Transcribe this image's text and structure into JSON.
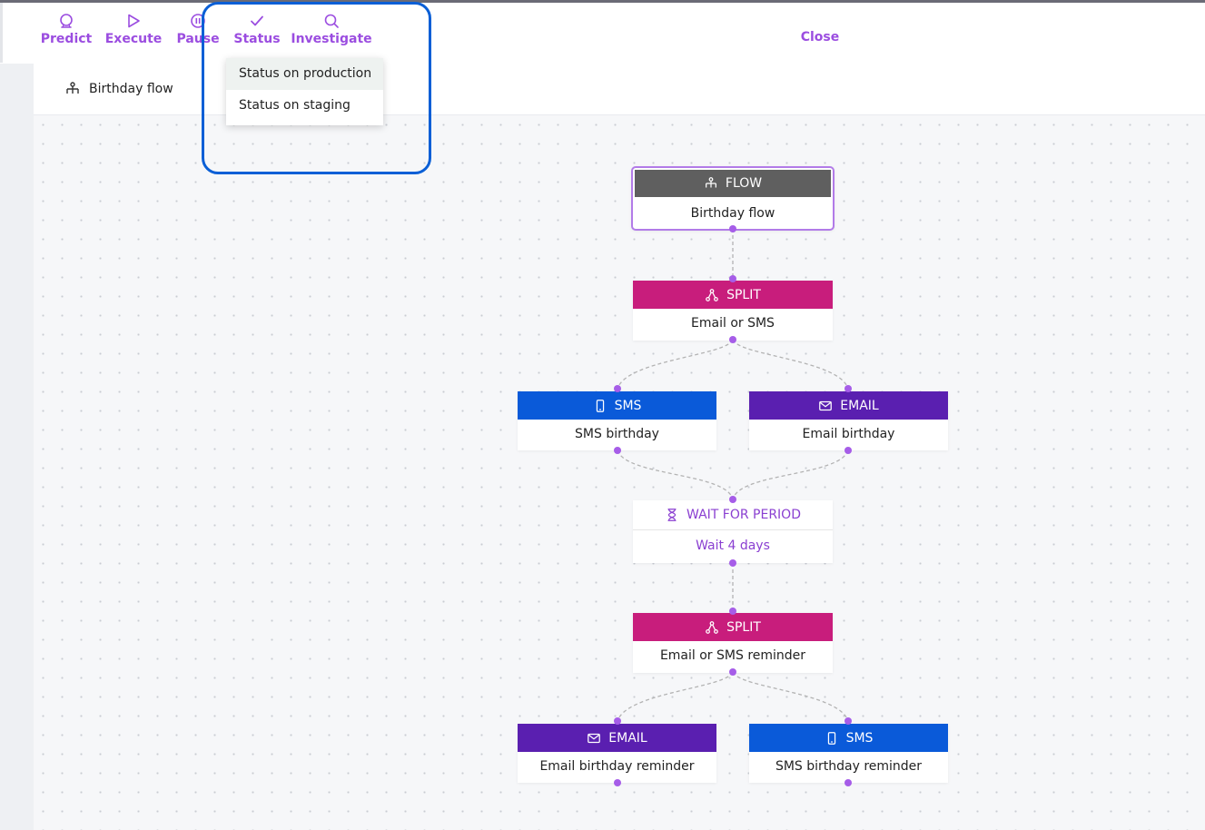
{
  "toolbar": {
    "predict": "Predict",
    "execute": "Execute",
    "pause": "Pause",
    "status": "Status",
    "investigate": "Investigate",
    "close": "Close"
  },
  "status_menu": {
    "items": [
      "Status on production",
      "Status on staging"
    ]
  },
  "breadcrumb": {
    "label": "Birthday flow"
  },
  "nodes": {
    "flow": {
      "type": "FLOW",
      "label": "Birthday flow"
    },
    "split1": {
      "type": "SPLIT",
      "label": "Email or SMS"
    },
    "sms1": {
      "type": "SMS",
      "label": "SMS birthday"
    },
    "email1": {
      "type": "EMAIL",
      "label": "Email birthday"
    },
    "wait": {
      "type": "WAIT FOR PERIOD",
      "label": "Wait 4 days"
    },
    "split2": {
      "type": "SPLIT",
      "label": "Email or SMS reminder"
    },
    "email2": {
      "type": "EMAIL",
      "label": "Email birthday reminder"
    },
    "sms2": {
      "type": "SMS",
      "label": "SMS birthday reminder"
    }
  },
  "colors": {
    "accent": "#9b4de0",
    "flow_header": "#5f5f5f",
    "split_header": "#c81d7c",
    "sms_header": "#0a5ad9",
    "email_header": "#5a1fb0",
    "wait_text": "#8a3fd1",
    "highlight_box": "#0a5fd6"
  }
}
